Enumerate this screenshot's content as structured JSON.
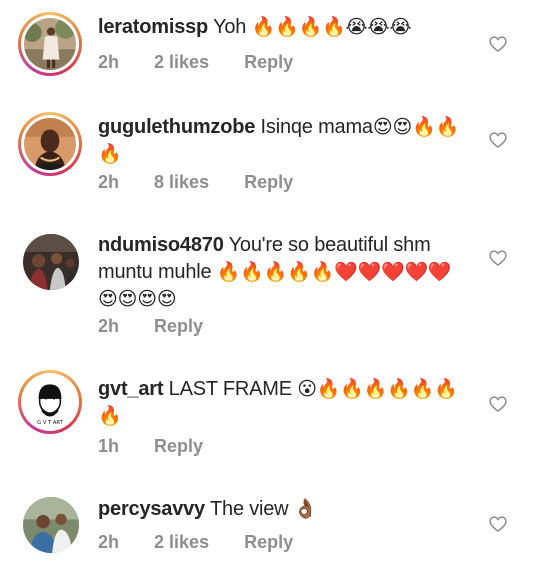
{
  "comments": [
    {
      "username": "leratomissp",
      "text": "Yoh",
      "emoji": "🔥🔥🔥🔥😭😭😭",
      "time": "2h",
      "likes": "2 likes",
      "reply": "Reply",
      "avatar_icon": "person-standing-avatar"
    },
    {
      "username": "gugulethumzobe",
      "text": "Isinqe mama",
      "emoji": "😍😍🔥🔥🔥",
      "time": "2h",
      "likes": "8 likes",
      "reply": "Reply",
      "avatar_icon": "woman-portrait-avatar"
    },
    {
      "username": "ndumiso4870",
      "text": "You're so beautiful shm muntu muhle",
      "emoji": "🔥🔥🔥🔥🔥❤️❤️❤️❤️❤️😍😍😍😍",
      "time": "2h",
      "likes": "",
      "reply": "Reply",
      "avatar_icon": "group-photo-avatar"
    },
    {
      "username": "gvt_art",
      "text": "LAST FRAME",
      "emoji": "😮🔥🔥🔥🔥🔥🔥🔥",
      "time": "1h",
      "likes": "",
      "reply": "Reply",
      "avatar_icon": "sketch-face-avatar"
    },
    {
      "username": "percysavvy",
      "text": "The view",
      "emoji": "👌🏾",
      "time": "2h",
      "likes": "2 likes",
      "reply": "Reply",
      "avatar_icon": "couple-photo-avatar"
    }
  ],
  "colors": {
    "text": "#262626",
    "meta": "#8e8e8e",
    "story_ring": "#d3394f"
  }
}
